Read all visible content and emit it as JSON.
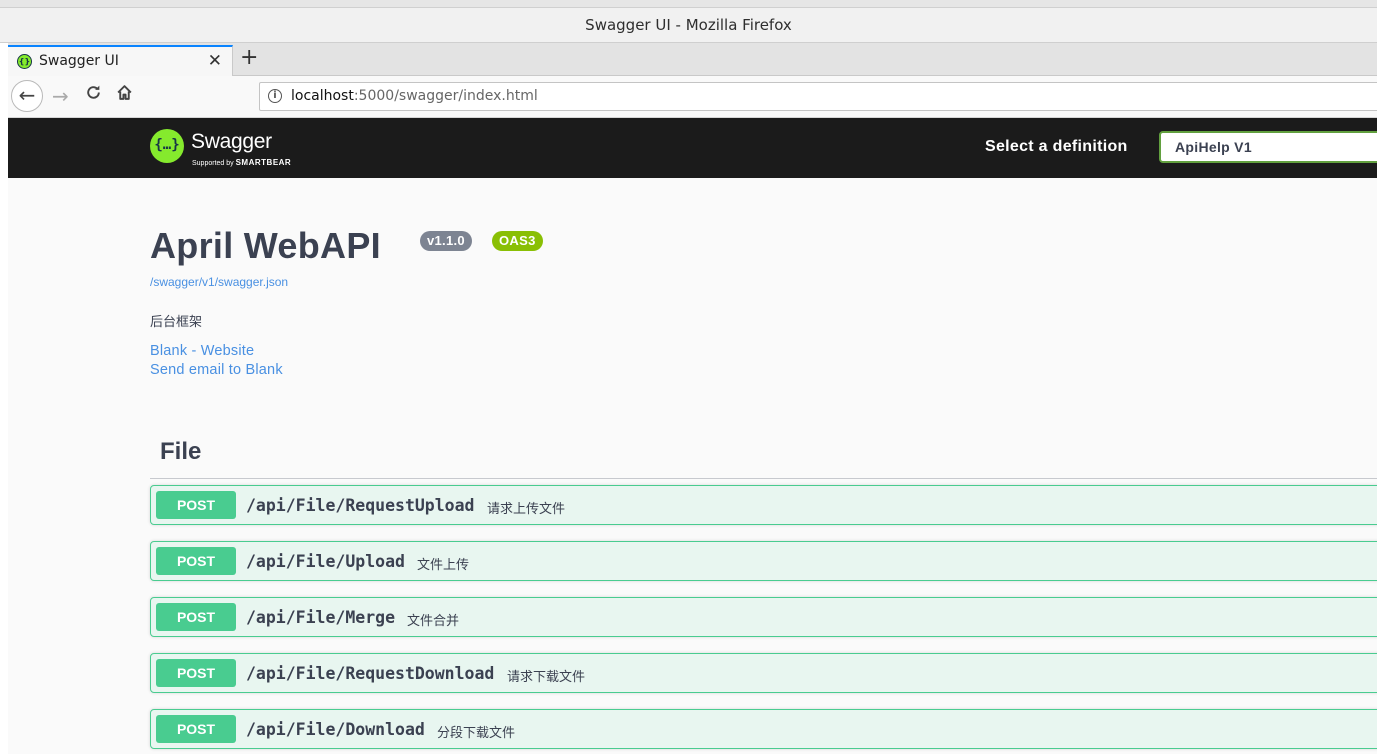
{
  "window": {
    "title": "Swagger UI - Mozilla Firefox"
  },
  "browser": {
    "tab_label": "Swagger UI",
    "url_host": "localhost",
    "url_rest": ":5000/swagger/index.html"
  },
  "header": {
    "logo_word": "Swagger",
    "logo_sub_prefix": "Supported by ",
    "logo_sub_brand": "SMARTBEAR",
    "definition_label": "Select a definition",
    "definition_value": "ApiHelp V1"
  },
  "info": {
    "title": "April WebAPI",
    "version_badge": "v1.1.0",
    "oas_badge": "OAS3",
    "json_link": "/swagger/v1/swagger.json",
    "description": "后台框架",
    "website_link": "Blank - Website",
    "email_link": "Send email to Blank"
  },
  "section": {
    "title": "File",
    "operations": [
      {
        "method": "POST",
        "path": "/api/File/RequestUpload",
        "summary": "请求上传文件"
      },
      {
        "method": "POST",
        "path": "/api/File/Upload",
        "summary": "文件上传"
      },
      {
        "method": "POST",
        "path": "/api/File/Merge",
        "summary": "文件合并"
      },
      {
        "method": "POST",
        "path": "/api/File/RequestDownload",
        "summary": "请求下载文件"
      },
      {
        "method": "POST",
        "path": "/api/File/Download",
        "summary": "分段下载文件"
      }
    ]
  },
  "colors": {
    "post_method": "#49cc90",
    "post_background": "#e8f6f0",
    "topbar": "#1b1b1b",
    "link": "#4990e2",
    "swagger_green": "#85ea2d"
  }
}
